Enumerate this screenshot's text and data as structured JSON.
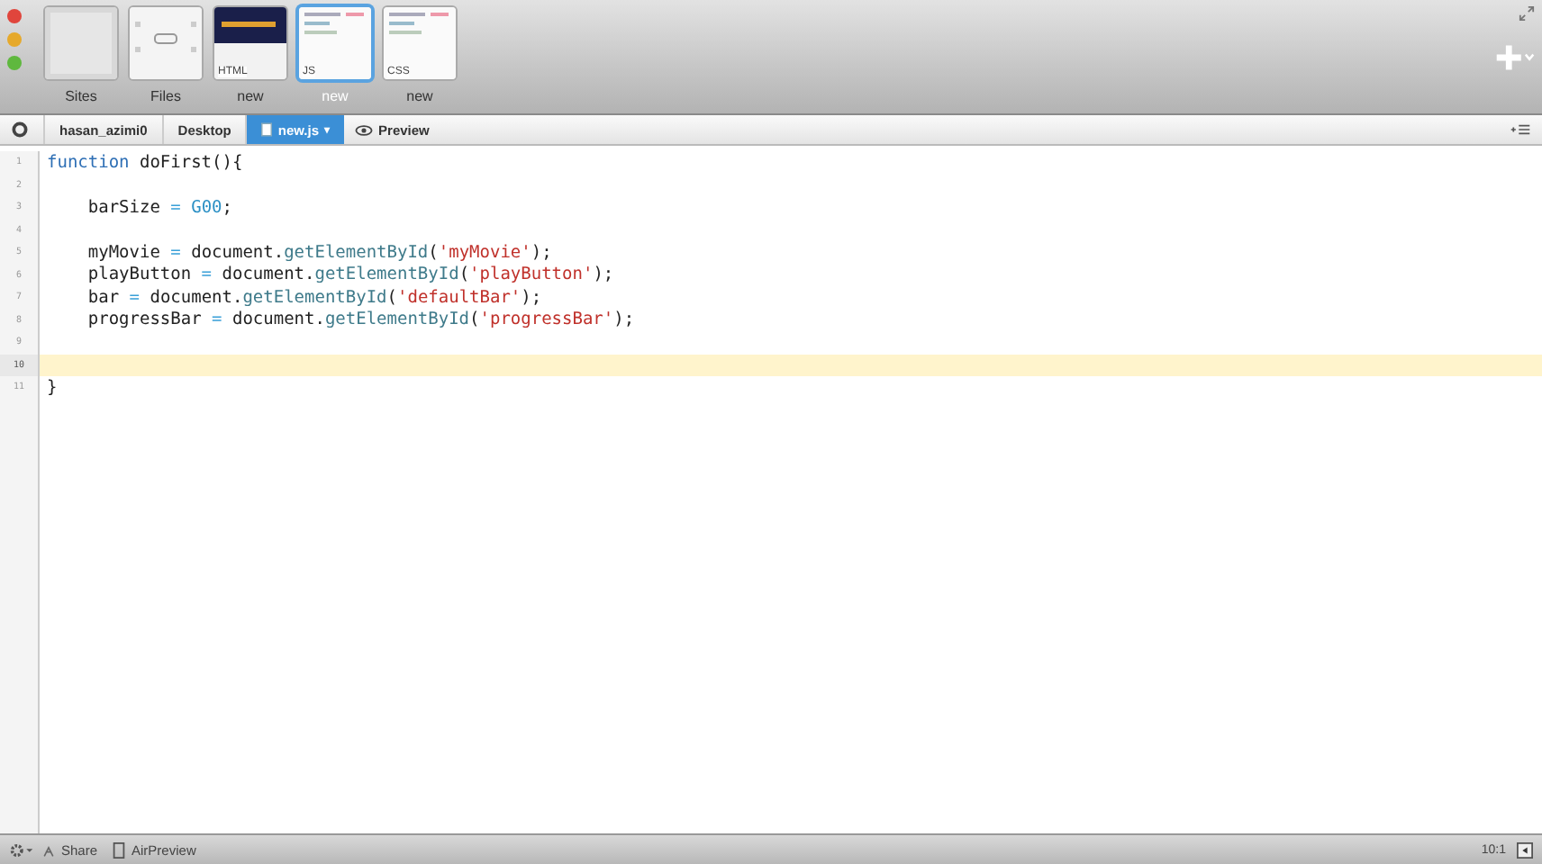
{
  "sites": [
    {
      "label": "Sites",
      "kind": "blank",
      "selected": false
    },
    {
      "label": "Files",
      "kind": "files",
      "selected": false
    },
    {
      "label": "new",
      "badge": "HTML",
      "kind": "dark",
      "selected": false
    },
    {
      "label": "new",
      "badge": "JS",
      "kind": "doc",
      "selected": true
    },
    {
      "label": "new",
      "badge": "CSS",
      "kind": "doc",
      "selected": false
    }
  ],
  "breadcrumb": [
    {
      "label": "hasan_azimi0",
      "selected": false
    },
    {
      "label": "Desktop",
      "selected": false
    },
    {
      "label": "new.js",
      "caret": "▾",
      "selected": true
    }
  ],
  "preview": "Preview",
  "lines": [
    {
      "number": "1",
      "current": false,
      "tokens": [
        {
          "t": "function",
          "kind": "keyword"
        },
        {
          "t": " doFirst(){",
          "kind": "plain"
        }
      ]
    },
    {
      "number": "2",
      "current": false
    },
    {
      "number": "3",
      "current": false,
      "tokens": [
        {
          "t": "    barSize ",
          "kind": "plain"
        },
        {
          "t": "=",
          "kind": "op"
        },
        {
          "t": " G00",
          "kind": "number"
        },
        {
          "t": ";",
          "kind": "plain"
        }
      ]
    },
    {
      "number": "4",
      "current": false
    },
    {
      "number": "5",
      "current": false,
      "tokens": [
        {
          "t": "    myMovie ",
          "kind": "plain"
        },
        {
          "t": "=",
          "kind": "op"
        },
        {
          "t": " document.",
          "kind": "plain"
        },
        {
          "t": "getElementById",
          "kind": "method"
        },
        {
          "t": "(",
          "kind": "plain"
        },
        {
          "t": "'myMovie'",
          "kind": "string"
        },
        {
          "t": ");",
          "kind": "plain"
        }
      ]
    },
    {
      "number": "6",
      "current": false,
      "tokens": [
        {
          "t": "    playButton ",
          "kind": "plain"
        },
        {
          "t": "=",
          "kind": "op"
        },
        {
          "t": " document.",
          "kind": "plain"
        },
        {
          "t": "getElementById",
          "kind": "method"
        },
        {
          "t": "(",
          "kind": "plain"
        },
        {
          "t": "'playButton'",
          "kind": "string"
        },
        {
          "t": ");",
          "kind": "plain"
        }
      ]
    },
    {
      "number": "7",
      "current": false,
      "tokens": [
        {
          "t": "    bar ",
          "kind": "plain"
        },
        {
          "t": "=",
          "kind": "op"
        },
        {
          "t": " document.",
          "kind": "plain"
        },
        {
          "t": "getElementById",
          "kind": "method"
        },
        {
          "t": "(",
          "kind": "plain"
        },
        {
          "t": "'defaultBar'",
          "kind": "string"
        },
        {
          "t": ");",
          "kind": "plain"
        }
      ]
    },
    {
      "number": "8",
      "current": false,
      "tokens": [
        {
          "t": "    progressBar ",
          "kind": "plain"
        },
        {
          "t": "=",
          "kind": "op"
        },
        {
          "t": " document.",
          "kind": "plain"
        },
        {
          "t": "getElementById",
          "kind": "method"
        },
        {
          "t": "(",
          "kind": "plain"
        },
        {
          "t": "'progressBar'",
          "kind": "string"
        },
        {
          "t": ");",
          "kind": "plain"
        }
      ]
    },
    {
      "number": "9",
      "current": false
    },
    {
      "number": "10",
      "current": true
    },
    {
      "number": "11",
      "current": false,
      "tokens": [
        {
          "t": "}",
          "kind": "plain"
        }
      ]
    }
  ],
  "status": {
    "share": "Share",
    "airpreview": "AirPreview",
    "position": "10:1"
  }
}
